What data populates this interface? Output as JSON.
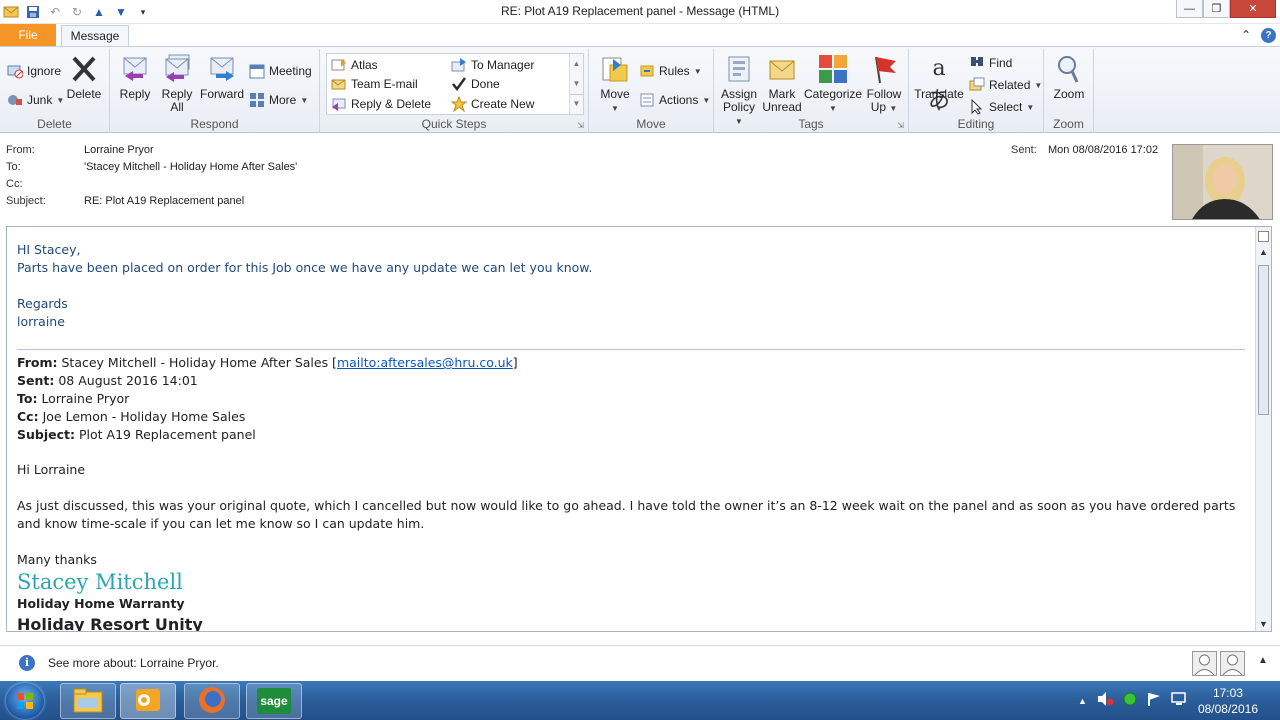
{
  "window": {
    "title": "RE: Plot A19 Replacement panel  -  Message (HTML)"
  },
  "ribbon": {
    "tabs": {
      "file": "File",
      "message": "Message"
    },
    "groups": {
      "delete": {
        "label": "Delete",
        "ignore": "Ignore",
        "junk": "Junk",
        "delete": "Delete"
      },
      "respond": {
        "label": "Respond",
        "reply": "Reply",
        "reply_all_1": "Reply",
        "reply_all_2": "All",
        "forward": "Forward",
        "meeting": "Meeting",
        "more": "More"
      },
      "quick_steps": {
        "label": "Quick Steps",
        "items": [
          "Atlas",
          "Team E-mail",
          "Reply & Delete",
          "To Manager",
          "Done",
          "Create New"
        ]
      },
      "move": {
        "label": "Move",
        "move": "Move",
        "rules": "Rules",
        "actions": "Actions"
      },
      "tags": {
        "label": "Tags",
        "assign_1": "Assign",
        "assign_2": "Policy",
        "mark_1": "Mark",
        "mark_2": "Unread",
        "categorize": "Categorize",
        "follow_1": "Follow",
        "follow_2": "Up"
      },
      "editing": {
        "label": "Editing",
        "translate": "Translate",
        "find": "Find",
        "related": "Related",
        "select": "Select"
      },
      "zoom": {
        "label": "Zoom",
        "zoom": "Zoom"
      }
    }
  },
  "header": {
    "from_label": "From:",
    "from": "Lorraine Pryor",
    "to_label": "To:",
    "to": "'Stacey Mitchell - Holiday Home After Sales'",
    "cc_label": "Cc:",
    "cc": "",
    "subject_label": "Subject:",
    "subject": "RE: Plot A19 Replacement panel",
    "sent_label": "Sent:",
    "sent": "Mon 08/08/2016 17:02"
  },
  "body": {
    "greeting": "HI Stacey,",
    "line1": "Parts have been placed on order for this Job once we have any update we can let you know.",
    "regards": "Regards",
    "signoff": "lorraine",
    "quoted": {
      "from_label": "From:",
      "from": "Stacey Mitchell - Holiday Home After Sales [",
      "from_link": "mailto:aftersales@hru.co.uk",
      "from_end": "]",
      "sent_label": "Sent:",
      "sent": "08 August 2016 14:01",
      "to_label": "To:",
      "to": "Lorraine Pryor",
      "cc_label": "Cc:",
      "cc": "Joe Lemon - Holiday Home Sales",
      "subject_label": "Subject:",
      "subject": "Plot A19 Replacement panel"
    },
    "hi": "Hi Lorraine",
    "para": "As just discussed, this was your original quote, which I cancelled but now would like to go ahead. I have told the owner it’s an 8-12 week wait on the panel and as soon as you have ordered parts and know time-scale if you can let me know so I can update him.",
    "thanks": "Many thanks",
    "sig_name": "Stacey Mitchell",
    "sig_title1": "Holiday Home Warranty",
    "sig_title2": "Holiday Resort Unity"
  },
  "people_pane": {
    "text": "See more about: Lorraine Pryor."
  },
  "taskbar": {
    "time": "17:03",
    "date": "08/08/2016",
    "sage_label": "sage"
  }
}
